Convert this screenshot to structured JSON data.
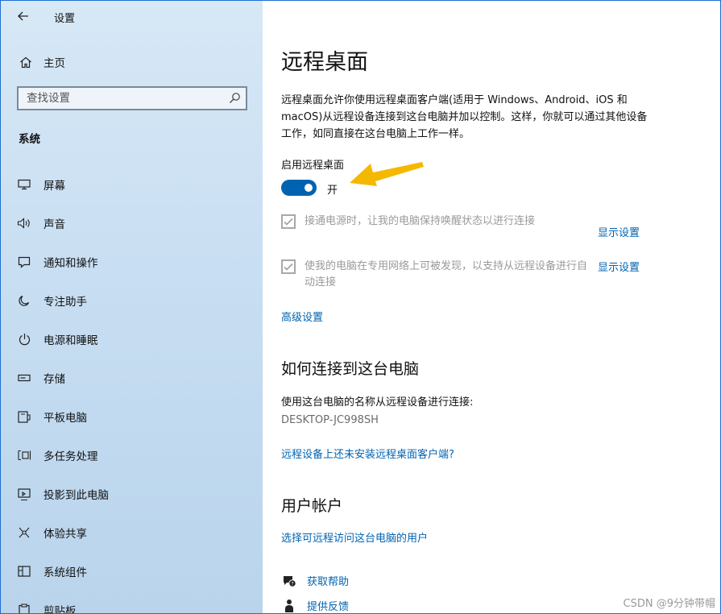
{
  "window": {
    "app_title": "设置",
    "controls": {
      "minimize": "minimize-icon",
      "maximize": "maximize-icon",
      "close": "close-icon"
    }
  },
  "sidebar": {
    "home_label": "主页",
    "search_placeholder": "查找设置",
    "section_label": "系统",
    "items": [
      {
        "label": "屏幕",
        "icon": "display-icon"
      },
      {
        "label": "声音",
        "icon": "speaker-icon"
      },
      {
        "label": "通知和操作",
        "icon": "notification-icon"
      },
      {
        "label": "专注助手",
        "icon": "moon-icon"
      },
      {
        "label": "电源和睡眠",
        "icon": "power-icon"
      },
      {
        "label": "存储",
        "icon": "storage-icon"
      },
      {
        "label": "平板电脑",
        "icon": "tablet-icon"
      },
      {
        "label": "多任务处理",
        "icon": "multitask-icon"
      },
      {
        "label": "投影到此电脑",
        "icon": "project-icon"
      },
      {
        "label": "体验共享",
        "icon": "share-icon"
      },
      {
        "label": "系统组件",
        "icon": "components-icon"
      },
      {
        "label": "剪贴板",
        "icon": "clipboard-icon"
      }
    ]
  },
  "content": {
    "title": "远程桌面",
    "description": "远程桌面允许你使用远程桌面客户端(适用于 Windows、Android、iOS 和 macOS)从远程设备连接到这台电脑并加以控制。这样，你就可以通过其他设备工作，如同直接在这台电脑上工作一样。",
    "toggle_label": "启用远程桌面",
    "toggle_state": "开",
    "toggle_on": true,
    "option1": {
      "text": "接通电源时，让我的电脑保持唤醒状态以进行连接",
      "link": "显示设置",
      "checked": true
    },
    "option2": {
      "text": "使我的电脑在专用网络上可被发现，以支持从远程设备进行自动连接",
      "link": "显示设置",
      "checked": true
    },
    "advanced_link": "高级设置",
    "how_title": "如何连接到这台电脑",
    "how_text": "使用这台电脑的名称从远程设备进行连接:",
    "pc_name": "DESKTOP-JC998SH",
    "client_link": "远程设备上还未安装远程桌面客户端?",
    "accounts_title": "用户帐户",
    "accounts_link": "选择可远程访问这台电脑的用户",
    "help_link": "获取帮助",
    "feedback_link": "提供反馈"
  },
  "watermark": "CSDN @9分钟带帽",
  "colors": {
    "accent": "#0063b1",
    "toggle_on": "#0063b1",
    "arrow": "#f5b800",
    "sidebar_bg": "#c8def2"
  }
}
